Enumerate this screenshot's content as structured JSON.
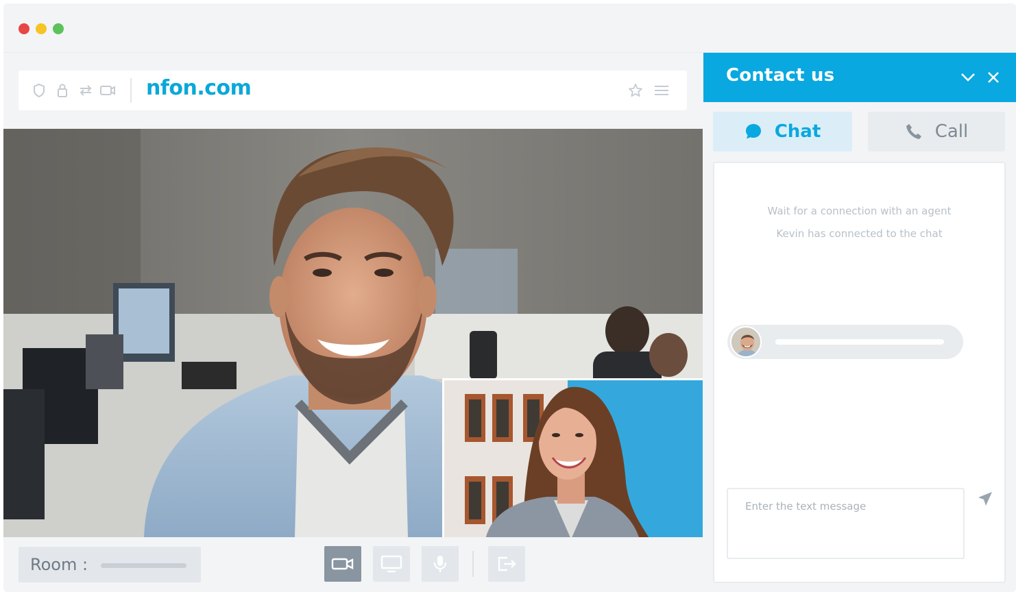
{
  "browser": {
    "url": "nfon.com",
    "icons": [
      "shield-icon",
      "lock-icon",
      "transfer-icon",
      "camera-icon",
      "star-icon",
      "menu-icon"
    ]
  },
  "video": {
    "room_label": "Room :",
    "controls": [
      "video-camera-icon",
      "screen-share-icon",
      "microphone-icon",
      "exit-icon"
    ]
  },
  "contact": {
    "title": "Contact us",
    "tabs": [
      {
        "label": "Chat",
        "icon": "chat-bubble-icon",
        "active": true
      },
      {
        "label": "Call",
        "icon": "phone-icon",
        "active": false
      }
    ],
    "system_messages": [
      "Wait for a connection with an agent",
      "Kevin has connected to the chat"
    ],
    "input_placeholder": "Enter the text message"
  },
  "colors": {
    "accent": "#0aa8e0",
    "window_bg": "#f2f4f6",
    "traffic_red": "#e84545",
    "traffic_yellow": "#f7c325",
    "traffic_green": "#5cc25a"
  }
}
